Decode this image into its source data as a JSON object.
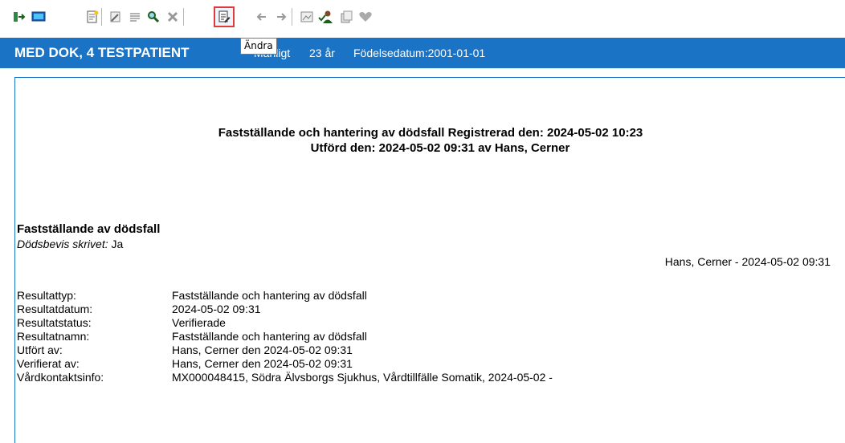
{
  "toolbar": {
    "tooltip": "Ändra",
    "icons": [
      "exit-icon",
      "monitor-icon",
      "new-document-icon",
      "sign-icon",
      "list-icon",
      "search-icon",
      "delete-icon",
      "edit-icon",
      "back-arrow-icon",
      "forward-arrow-icon",
      "image-icon",
      "person-check-icon",
      "copy-icon",
      "heart-icon"
    ]
  },
  "banner": {
    "patient_name": "MED DOK, 4 TESTPATIENT",
    "gender": "Manligt",
    "age": "23 år",
    "dob": "Födelsedatum:2001-01-01"
  },
  "document": {
    "header_line1": "Fastställande och hantering av dödsfall Registrerad den:  2024-05-02 10:23",
    "header_line2": "Utförd den:  2024-05-02 09:31  av Hans, Cerner",
    "section_title": "Fastställande av dödsfall",
    "dodsbevis_label": "Dödsbevis skrivet:",
    "dodsbevis_value": "Ja",
    "signer": "Hans, Cerner - 2024-05-02 09:31",
    "fields": [
      {
        "label": "Resultattyp:",
        "value": "Fastställande och hantering av dödsfall"
      },
      {
        "label": "Resultatdatum:",
        "value": "2024-05-02 09:31"
      },
      {
        "label": "Resultatstatus:",
        "value": "Verifierade"
      },
      {
        "label": "Resultatnamn:",
        "value": "Fastställande och hantering av dödsfall"
      },
      {
        "label": "Utfört av:",
        "value": "Hans, Cerner den 2024-05-02 09:31"
      },
      {
        "label": "Verifierat av:",
        "value": "Hans, Cerner den 2024-05-02 09:31"
      },
      {
        "label": "Vårdkontaktsinfo:",
        "value": "MX000048415, Södra Älvsborgs Sjukhus, Vårdtillfälle Somatik, 2024-05-02 -"
      }
    ]
  },
  "colors": {
    "banner": "#1a73c4",
    "highlight": "#e03a3a"
  }
}
